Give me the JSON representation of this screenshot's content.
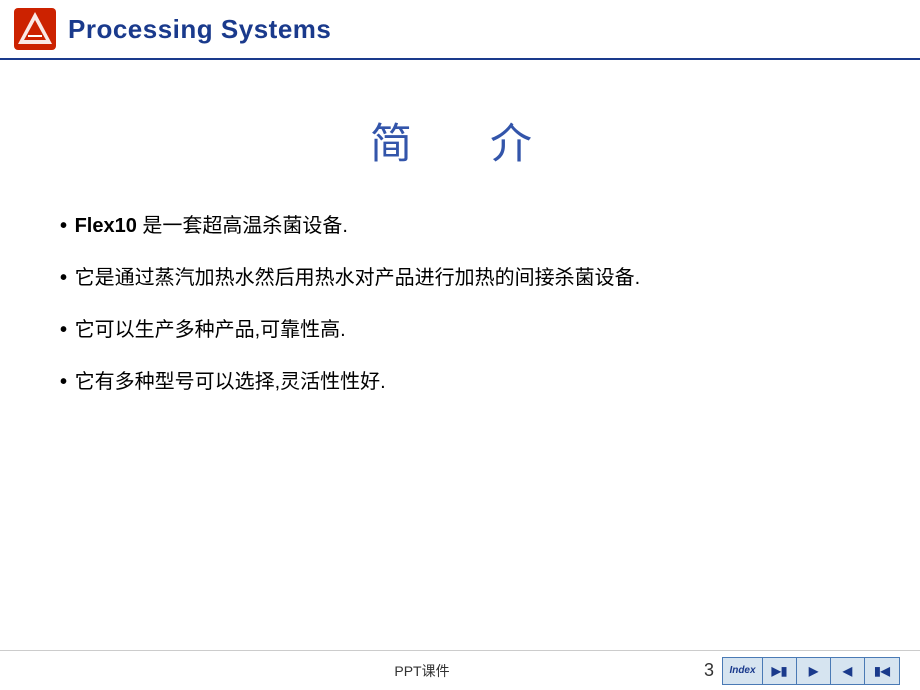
{
  "header": {
    "title": "Processing Systems",
    "logo_alt": "Tetra Pak logo"
  },
  "slide": {
    "title": "简　介",
    "bullets": [
      {
        "id": 1,
        "prefix_bold": "Flex10",
        "text": " 是一套超高温杀菌设备."
      },
      {
        "id": 2,
        "prefix_bold": "",
        "text": "它是通过蒸汽加热水然后用热水对产品进行加热的间接杀菌设备."
      },
      {
        "id": 3,
        "prefix_bold": "",
        "text": "它可以生产多种产品,可靠性高."
      },
      {
        "id": 4,
        "prefix_bold": "",
        "text": "它有多种型号可以选择,灵活性性好."
      }
    ]
  },
  "footer": {
    "center_text": "PPT课件",
    "page_number": "3",
    "nav": {
      "index_label": "Index",
      "btn_next_end": "▶|",
      "btn_next": "▶",
      "btn_prev": "◀",
      "btn_prev_end": "|◀"
    }
  },
  "colors": {
    "header_title": "#1a3a8c",
    "slide_title": "#3355aa",
    "nav_bg": "#d6e4f0",
    "nav_border": "#4a7ab5"
  }
}
